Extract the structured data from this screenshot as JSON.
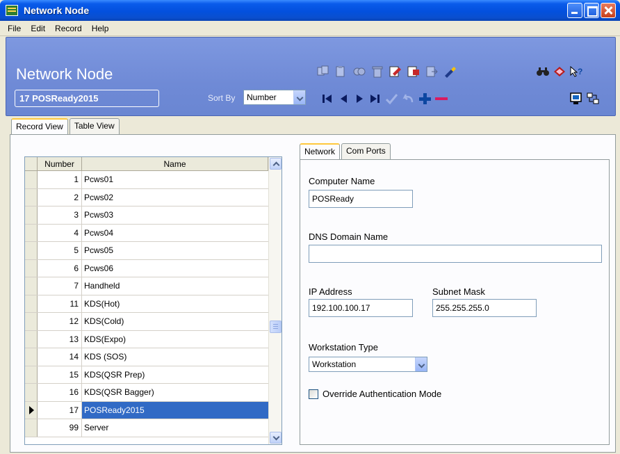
{
  "window": {
    "title": "Network Node"
  },
  "menu": [
    "File",
    "Edit",
    "Record",
    "Help"
  ],
  "header": {
    "title": "Network Node",
    "current_record": "17 POSReady2015",
    "sort_by_label": "Sort By",
    "sort_by_value": "Number"
  },
  "view_tabs": [
    "Record View",
    "Table View"
  ],
  "grid": {
    "columns": [
      "Number",
      "Name"
    ],
    "rows": [
      {
        "number": "1",
        "name": "Pcws01"
      },
      {
        "number": "2",
        "name": "Pcws02"
      },
      {
        "number": "3",
        "name": "Pcws03"
      },
      {
        "number": "4",
        "name": "Pcws04"
      },
      {
        "number": "5",
        "name": "Pcws05"
      },
      {
        "number": "6",
        "name": "Pcws06"
      },
      {
        "number": "7",
        "name": "Handheld"
      },
      {
        "number": "11",
        "name": "KDS(Hot)"
      },
      {
        "number": "12",
        "name": "KDS(Cold)"
      },
      {
        "number": "13",
        "name": "KDS(Expo)"
      },
      {
        "number": "14",
        "name": "KDS (SOS)"
      },
      {
        "number": "15",
        "name": "KDS(QSR Prep)"
      },
      {
        "number": "16",
        "name": "KDS(QSR Bagger)"
      },
      {
        "number": "17",
        "name": "POSReady2015"
      },
      {
        "number": "99",
        "name": "Server"
      }
    ],
    "selected_number": "17"
  },
  "detail_tabs": [
    "Network",
    "Com Ports"
  ],
  "network": {
    "computer_name_label": "Computer Name",
    "computer_name": "POSReady",
    "dns_label": "DNS Domain Name",
    "dns_value": "",
    "ip_label": "IP Address",
    "ip_value": "192.100.100.17",
    "subnet_label": "Subnet Mask",
    "subnet_value": "255.255.255.0",
    "workstation_type_label": "Workstation Type",
    "workstation_type": "Workstation",
    "override_label": "Override Authentication Mode",
    "override_checked": false
  },
  "colors": {
    "header_band": "#7290DC",
    "selection": "#316AC5",
    "title_bar": "#0A5BEA"
  },
  "toolbar_icons": [
    "copy-record-icon",
    "paste-record-icon",
    "duplicate-icon",
    "delete-icon",
    "edit-icon",
    "import-icon",
    "export-icon",
    "clear-icon",
    "first-record-icon",
    "previous-record-icon",
    "next-record-icon",
    "last-record-icon",
    "save-check-icon",
    "undo-icon",
    "add-record-icon",
    "remove-record-icon",
    "find-binoculars-icon",
    "help-book-icon",
    "whats-this-icon",
    "screen-icon",
    "connect-icon"
  ]
}
